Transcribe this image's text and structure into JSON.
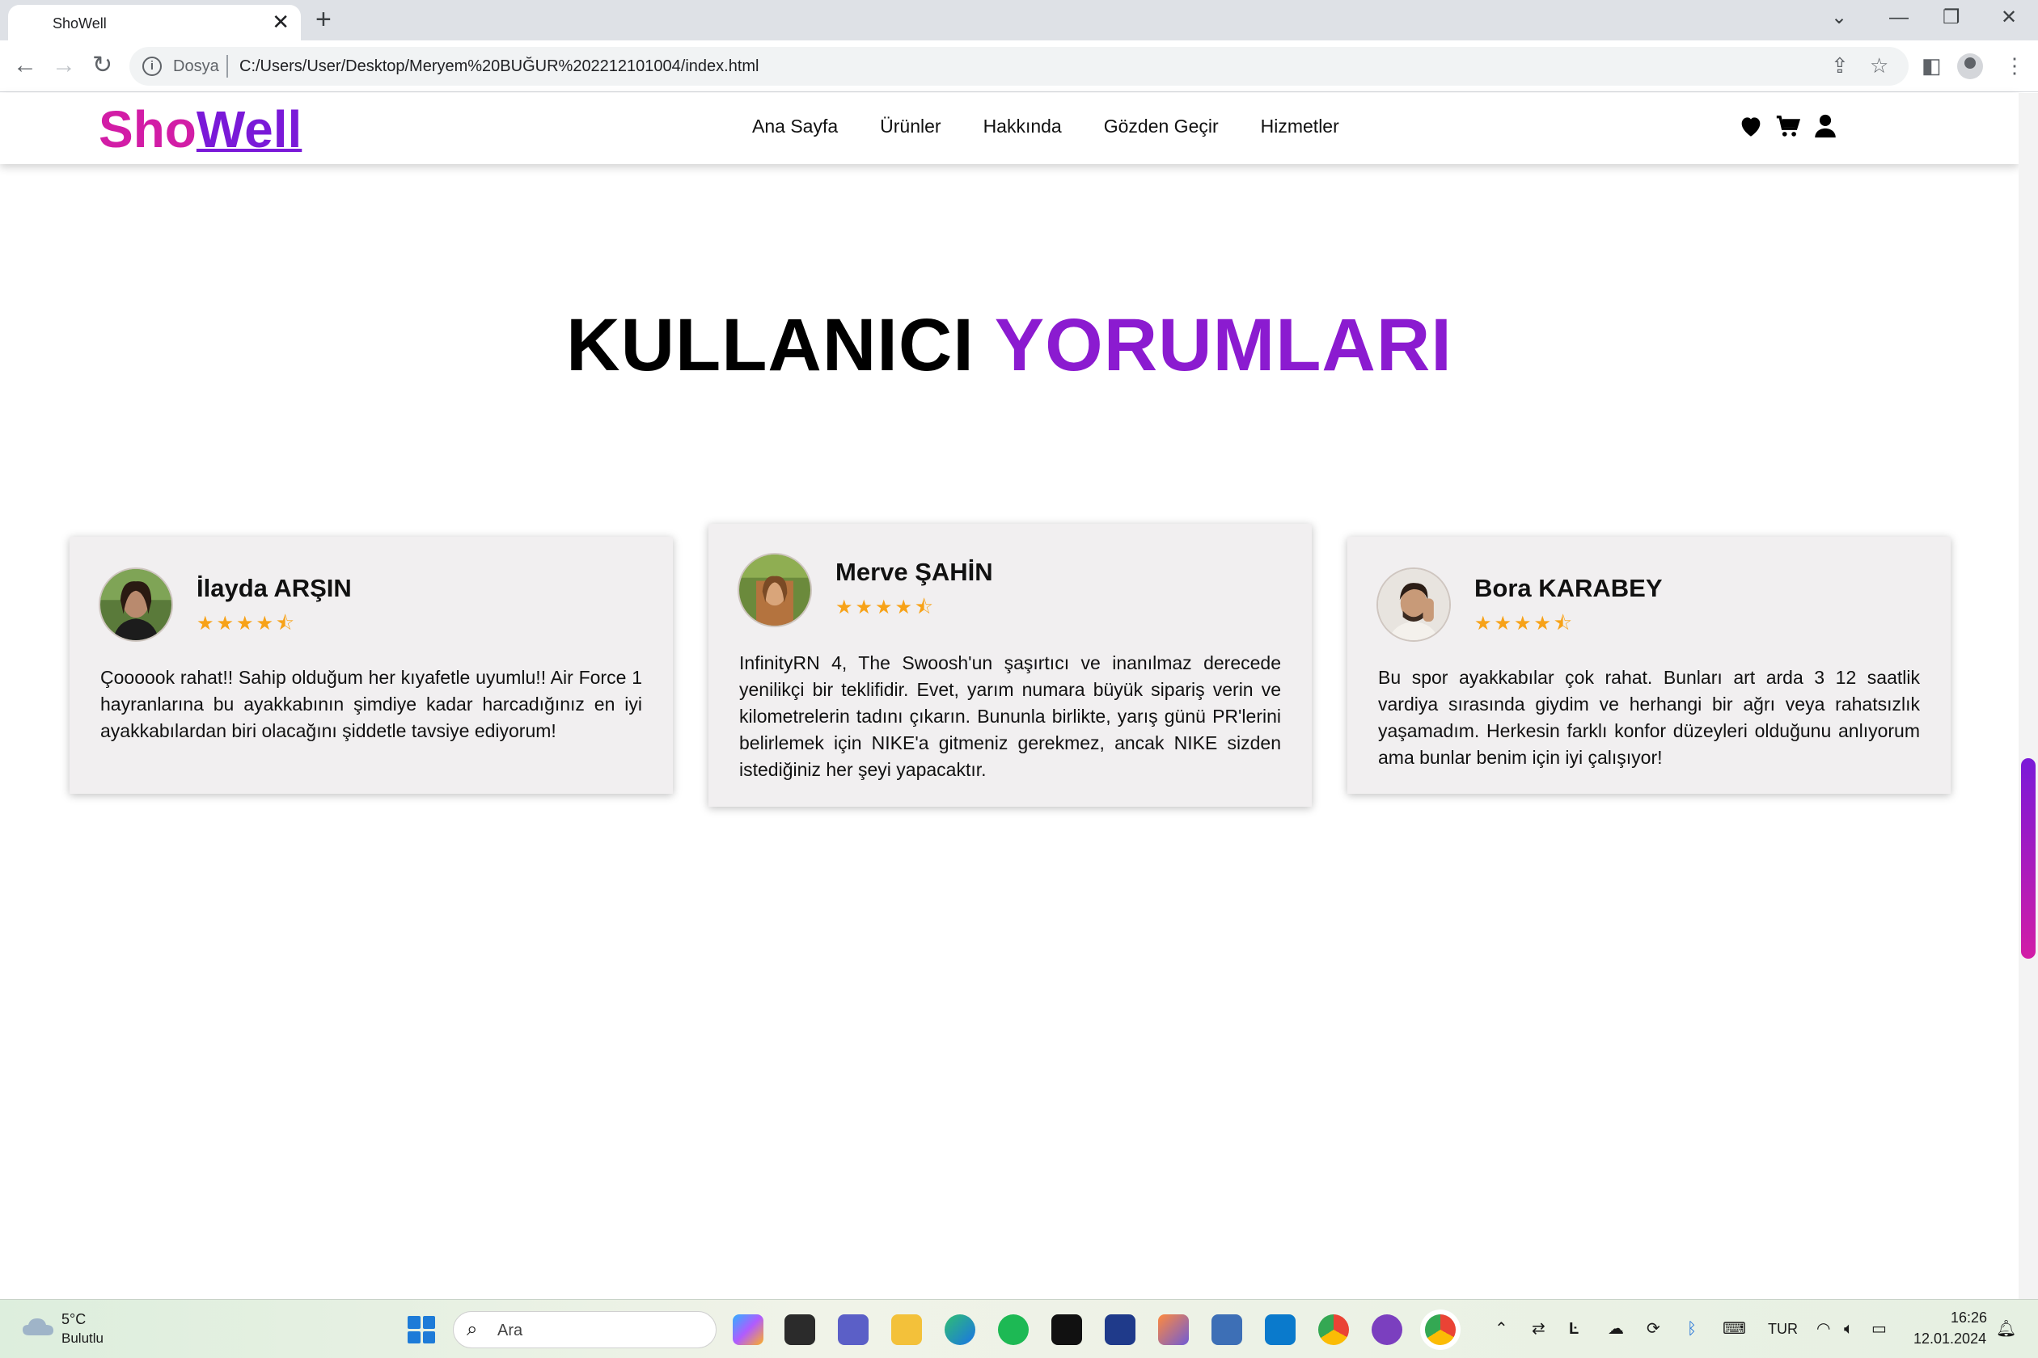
{
  "browser": {
    "tab_title": "ShoWell",
    "tab_close": "✕",
    "new_tab": "+",
    "scheme_label": "Dosya",
    "url": "C:/Users/User/Desktop/Meryem%20BUĞUR%202212101004/index.html"
  },
  "site": {
    "logo_part1": "Sho",
    "logo_part2": "Well",
    "nav": [
      "Ana Sayfa",
      "Ürünler",
      "Hakkında",
      "Gözden Geçir",
      "Hizmetler"
    ],
    "header_icons": [
      "heart-icon",
      "cart-icon",
      "user-icon"
    ]
  },
  "section": {
    "title_part1": "KULLANICI",
    "title_part2": "YORUMLARI"
  },
  "reviews": [
    {
      "name": "İlayda ARŞIN",
      "stars": "★★★★⯪",
      "rating": 4.5,
      "text": "Çoooook rahat!! Sahip olduğum her kıyafetle uyumlu!! Air Force 1 hayranlarına bu ayakkabının şimdiye kadar harcadığınız en iyi ayakkabılardan biri olacağını şiddetle tavsiye ediyorum!"
    },
    {
      "name": "Merve ŞAHİN",
      "stars": "★★★★⯪",
      "rating": 4.5,
      "text": "InfinityRN 4, The Swoosh'un şaşırtıcı ve inanılmaz derecede yenilikçi bir teklifidir. Evet, yarım numara büyük sipariş verin ve kilometrelerin tadını çıkarın. Bununla birlikte, yarış günü PR'lerini belirlemek için NIKE'a gitmeniz gerekmez, ancak NIKE sizden istediğiniz her şeyi yapacaktır."
    },
    {
      "name": "Bora KARABEY",
      "stars": "★★★★⯪",
      "rating": 4.5,
      "text": "Bu spor ayakkabılar çok rahat. Bunları art arda 3 12 saatlik vardiya sırasında giydim ve herhangi bir ağrı veya rahatsızlık yaşamadım. Herkesin farklı konfor düzeyleri olduğunu anlıyorum ama bunlar benim için iyi çalışıyor!"
    }
  ],
  "taskbar": {
    "temp": "5°C",
    "weather": "Bulutlu",
    "search_placeholder": "Ara",
    "lang": "TUR",
    "time": "16:26",
    "date": "12.01.2024"
  },
  "colors": {
    "logo_pink": "#d21da6",
    "logo_purple": "#7a19d8",
    "star": "#f7a218",
    "card_bg": "#f1eff0"
  }
}
